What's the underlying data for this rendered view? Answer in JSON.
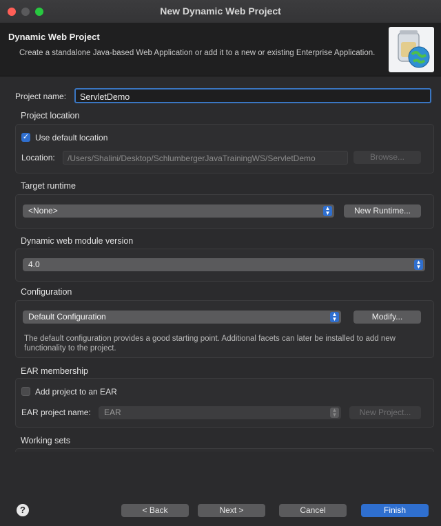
{
  "window": {
    "title": "New Dynamic Web Project"
  },
  "header": {
    "title": "Dynamic Web Project",
    "description": "Create a standalone Java-based Web Application or add it to a new or existing Enterprise Application."
  },
  "project_name": {
    "label": "Project name:",
    "value": "ServletDemo"
  },
  "project_location": {
    "label": "Project location",
    "use_default_label": "Use default location",
    "use_default_checked": true,
    "location_label": "Location:",
    "location_value": "/Users/Shalini/Desktop/SchlumbergerJavaTrainingWS/ServletDemo",
    "browse_label": "Browse..."
  },
  "target_runtime": {
    "label": "Target runtime",
    "selected": "<None>",
    "new_runtime_label": "New Runtime..."
  },
  "module_version": {
    "label": "Dynamic web module version",
    "selected": "4.0"
  },
  "configuration": {
    "label": "Configuration",
    "selected": "Default Configuration",
    "modify_label": "Modify...",
    "description": "The default configuration provides a good starting point. Additional facets can later be installed to add new functionality to the project."
  },
  "ear_membership": {
    "label": "EAR membership",
    "add_label": "Add project to an EAR",
    "add_checked": false,
    "ear_name_label": "EAR project name:",
    "ear_name_value": "EAR",
    "new_project_label": "New Project..."
  },
  "working_sets": {
    "label": "Working sets"
  },
  "footer": {
    "help": "?",
    "back_label": "< Back",
    "next_label": "Next >",
    "cancel_label": "Cancel",
    "finish_label": "Finish"
  },
  "colors": {
    "accent": "#2f6fcf",
    "focus_border": "#3a76c2",
    "close": "#ff5f57",
    "maximize": "#28c840"
  }
}
